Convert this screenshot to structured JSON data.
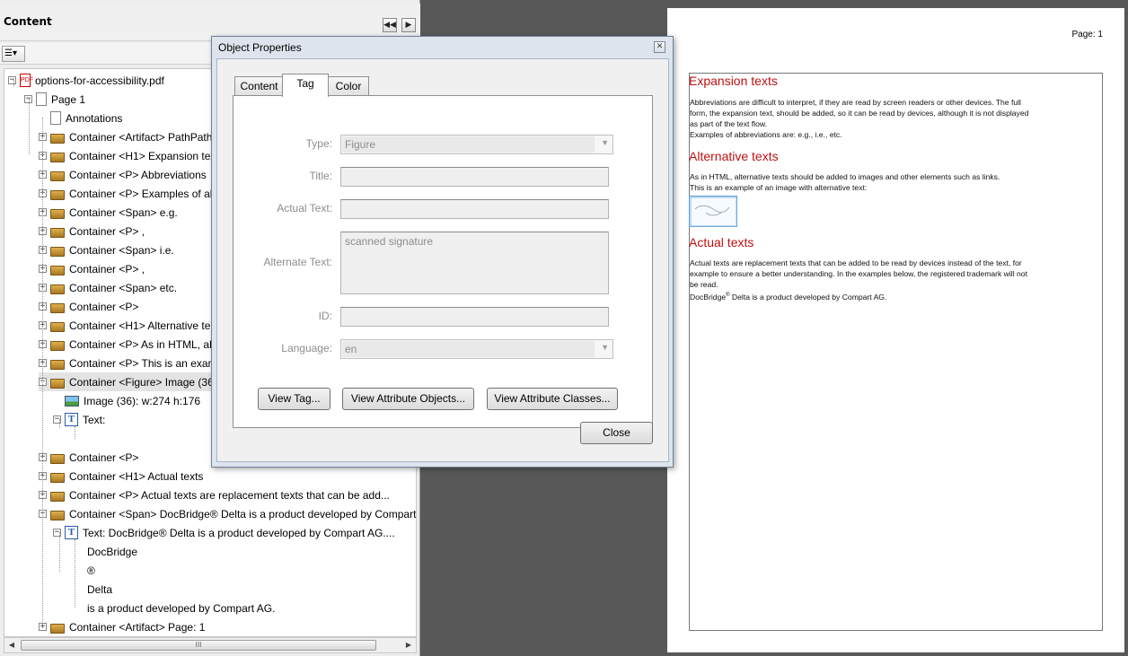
{
  "content_panel": {
    "title": "Content",
    "prev_icon": "double-left-arrow-icon",
    "next_icon": "right-arrow-icon",
    "options_icon": "options-menu-icon",
    "tree": [
      {
        "level": 0,
        "expander": "-",
        "icon": "pdf",
        "label": "options-for-accessibility.pdf"
      },
      {
        "level": 1,
        "expander": "-",
        "icon": "page",
        "label": "Page 1"
      },
      {
        "level": 2,
        "expander": "",
        "icon": "page",
        "label": "Annotations"
      },
      {
        "level": 2,
        "expander": "+",
        "icon": "box",
        "label": "Container <Artifact> PathPath"
      },
      {
        "level": 2,
        "expander": "+",
        "icon": "box",
        "label": "Container <H1> Expansion tex"
      },
      {
        "level": 2,
        "expander": "+",
        "icon": "box",
        "label": "Container <P> Abbreviations"
      },
      {
        "level": 2,
        "expander": "+",
        "icon": "box",
        "label": "Container <P> Examples of ab"
      },
      {
        "level": 2,
        "expander": "+",
        "icon": "box",
        "label": "Container <Span> e.g."
      },
      {
        "level": 2,
        "expander": "+",
        "icon": "box",
        "label": "Container <P> ,"
      },
      {
        "level": 2,
        "expander": "+",
        "icon": "box",
        "label": "Container <Span> i.e."
      },
      {
        "level": 2,
        "expander": "+",
        "icon": "box",
        "label": "Container <P> ,"
      },
      {
        "level": 2,
        "expander": "+",
        "icon": "box",
        "label": "Container <Span> etc."
      },
      {
        "level": 2,
        "expander": "+",
        "icon": "box",
        "label": "Container <P>"
      },
      {
        "level": 2,
        "expander": "+",
        "icon": "box",
        "label": "Container <H1> Alternative te"
      },
      {
        "level": 2,
        "expander": "+",
        "icon": "box",
        "label": "Container <P> As in HTML, al"
      },
      {
        "level": 2,
        "expander": "+",
        "icon": "box",
        "label": "Container <P> This is an exam"
      },
      {
        "level": 2,
        "expander": "-",
        "icon": "box",
        "label": "Container <Figure> Image (36",
        "selected": true
      },
      {
        "level": 3,
        "expander": "",
        "icon": "image",
        "label": "Image (36): w:274 h:176"
      },
      {
        "level": 3,
        "expander": "-",
        "icon": "text",
        "label": "Text:"
      },
      {
        "level": 4,
        "expander": "",
        "icon": "",
        "label": ""
      },
      {
        "level": 2,
        "expander": "+",
        "icon": "box",
        "label": "Container <P>"
      },
      {
        "level": 2,
        "expander": "+",
        "icon": "box",
        "label": "Container <H1> Actual texts"
      },
      {
        "level": 2,
        "expander": "+",
        "icon": "box",
        "label": "Container <P> Actual texts are replacement texts that can be add..."
      },
      {
        "level": 2,
        "expander": "-",
        "icon": "box",
        "label": "Container <Span> DocBridge® Delta is a product developed by Compart"
      },
      {
        "level": 3,
        "expander": "-",
        "icon": "text",
        "label": "Text: DocBridge® Delta is a product developed by Compart AG...."
      },
      {
        "level": 4,
        "expander": "",
        "icon": "",
        "label": "DocBridge"
      },
      {
        "level": 4,
        "expander": "",
        "icon": "",
        "label": "®"
      },
      {
        "level": 4,
        "expander": "",
        "icon": "",
        "label": "Delta"
      },
      {
        "level": 4,
        "expander": "",
        "icon": "",
        "label": "is a product developed by Compart AG."
      },
      {
        "level": 2,
        "expander": "+",
        "icon": "box",
        "label": "Container <Artifact> Page: 1"
      }
    ],
    "scroll_thumb_grip": "III"
  },
  "dialog": {
    "title": "Object Properties",
    "close_icon": "close-x-icon",
    "tabs": [
      "Content",
      "Tag",
      "Color"
    ],
    "active_tab": "Tag",
    "fields": {
      "type_label": "Type:",
      "type_value": "Figure",
      "title_label": "Title:",
      "title_value": "",
      "actual_text_label": "Actual Text:",
      "actual_text_value": "",
      "alternate_text_label": "Alternate Text:",
      "alternate_text_value": "scanned signature",
      "id_label": "ID:",
      "id_value": "",
      "language_label": "Language:",
      "language_value": "en"
    },
    "buttons": {
      "view_tag": "View Tag...",
      "view_attribute_objects": "View Attribute Objects...",
      "view_attribute_classes": "View Attribute Classes...",
      "close": "Close"
    }
  },
  "document": {
    "page_number": "Page: 1",
    "heading_color": "#c01010",
    "sections": {
      "expansion_heading": "Expansion texts",
      "expansion_p1_l1": "Abbreviations are difficult to interpret, if they are read by screen readers or other devices. The full",
      "expansion_p1_l2": "form, the expansion text, should be added, so it can be read by devices, although it is not displayed",
      "expansion_p1_l3": "as part of the text flow.",
      "expansion_p2": "Examples of abbreviations are: e.g., i.e., etc.",
      "alternative_heading": "Alternative texts",
      "alternative_p1": "As in HTML, alternative texts should be added to images and other elements such as links.",
      "alternative_p2": "This is an example of an image with alternative text:",
      "actual_heading": "Actual texts",
      "actual_p1_l1": "Actual texts are replacement texts that can be added to be read by devices instead of the text, for",
      "actual_p1_l2": "example to ensure a better understanding. In the examples below, the registered trademark will not",
      "actual_p1_l3": "be read.",
      "actual_p2_a": "DocBridge",
      "actual_p2_sup": "®",
      "actual_p2_b": " Delta is a product developed by Compart AG."
    }
  }
}
